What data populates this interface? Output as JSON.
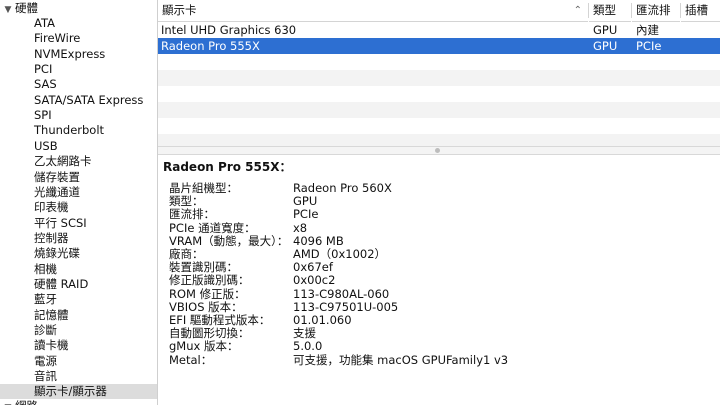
{
  "sidebar": {
    "section_hardware": "硬體",
    "items": [
      "ATA",
      "FireWire",
      "NVMExpress",
      "PCI",
      "SAS",
      "SATA/SATA Express",
      "SPI",
      "Thunderbolt",
      "USB",
      "乙太網路卡",
      "儲存裝置",
      "光纖通道",
      "印表機",
      "平行 SCSI",
      "控制器",
      "燒錄光碟",
      "相機",
      "硬體 RAID",
      "藍牙",
      "記憶體",
      "診斷",
      "讀卡機",
      "電源",
      "音訊",
      "顯示卡/顯示器"
    ],
    "selected_item": "顯示卡/顯示器",
    "section_network": "網路"
  },
  "table": {
    "headers": [
      "顯示卡",
      "類型",
      "匯流排",
      "插槽"
    ],
    "sort_indicator": "⌃",
    "rows": [
      {
        "name": "Intel UHD Graphics 630",
        "type": "GPU",
        "bus": "內建",
        "slot": "",
        "selected": false
      },
      {
        "name": "Radeon Pro 555X",
        "type": "GPU",
        "bus": "PCIe",
        "slot": "",
        "selected": true
      }
    ]
  },
  "detail": {
    "title": "Radeon Pro 555X：",
    "fields": [
      {
        "key": "晶片組機型：",
        "value": "Radeon Pro 560X"
      },
      {
        "key": "類型：",
        "value": "GPU"
      },
      {
        "key": "匯流排：",
        "value": "PCIe"
      },
      {
        "key": "PCIe 通道寬度：",
        "value": "x8"
      },
      {
        "key": "VRAM（動態，最大）：",
        "value": "4096 MB"
      },
      {
        "key": "廠商：",
        "value": "AMD（0x1002）"
      },
      {
        "key": "裝置識別碼：",
        "value": "0x67ef"
      },
      {
        "key": "修正版識別碼：",
        "value": "0x00c2"
      },
      {
        "key": "ROM 修正版：",
        "value": "113-C980AL-060"
      },
      {
        "key": "VBIOS 版本：",
        "value": "113-C97501U-005"
      },
      {
        "key": "EFI 驅動程式版本：",
        "value": "01.01.060"
      },
      {
        "key": "自動圖形切換：",
        "value": "支援"
      },
      {
        "key": "gMux 版本：",
        "value": "5.0.0"
      },
      {
        "key": "Metal：",
        "value": "可支援，功能集 macOS GPUFamily1 v3"
      }
    ]
  }
}
